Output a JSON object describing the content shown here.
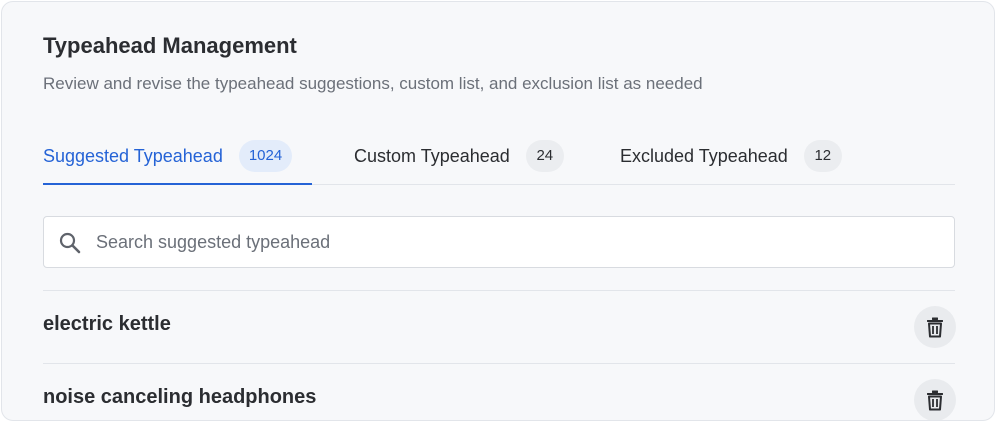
{
  "header": {
    "title": "Typeahead Management",
    "subtitle": "Review and revise the typeahead suggestions, custom list, and exclusion list as needed"
  },
  "tabs": [
    {
      "label": "Suggested Typeahead",
      "count": "1024",
      "active": true
    },
    {
      "label": "Custom Typeahead",
      "count": "24",
      "active": false
    },
    {
      "label": "Excluded Typeahead",
      "count": "12",
      "active": false
    }
  ],
  "search": {
    "placeholder": "Search suggested typeahead",
    "value": "",
    "icon": "search-icon"
  },
  "items": [
    {
      "label": "electric kettle",
      "action_icon": "trash-icon"
    },
    {
      "label": "noise canceling headphones",
      "action_icon": "trash-icon"
    }
  ],
  "colors": {
    "accent": "#2563d6",
    "text": "#2b2d31",
    "muted": "#6b7079",
    "background": "#f7f8fa"
  }
}
